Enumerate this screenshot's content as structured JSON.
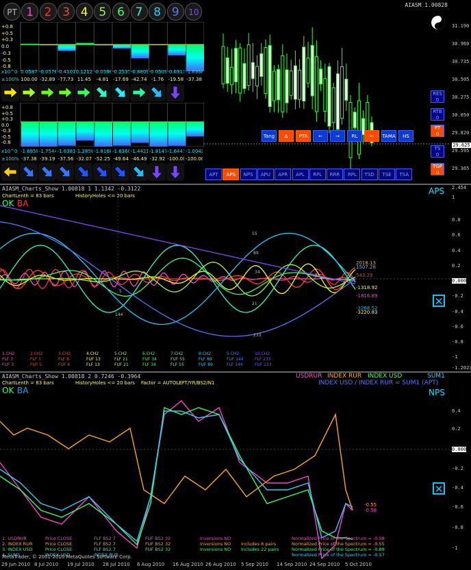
{
  "top": {
    "title": "AIASM 1.00828",
    "pt_label": "PT",
    "num_buttons": [
      {
        "label": "1",
        "color": "#ff44cc"
      },
      {
        "label": "2",
        "color": "#ff3333"
      },
      {
        "label": "3",
        "color": "#ff4422"
      },
      {
        "label": "4",
        "color": "#ffff00"
      },
      {
        "label": "5",
        "color": "#99ff33"
      },
      {
        "label": "6",
        "color": "#33ff66"
      },
      {
        "label": "7",
        "color": "#22ffcc"
      },
      {
        "label": "8",
        "color": "#22ccff"
      },
      {
        "label": "9",
        "color": "#5577ff"
      },
      {
        "label": "10",
        "color": "#8844ff"
      }
    ],
    "scale_a": [
      "+0.8",
      "+0.5",
      "+0.3",
      "0.0",
      "-0.3",
      "-0.5",
      "-0.8"
    ],
    "factor_label": "x10^0",
    "row_a_values": [
      "0.0587",
      "-0.0576",
      "-0.4101",
      "0.1212",
      "-0.0596",
      "-0.2535",
      "-0.8809",
      "-0.0509",
      "-0.6913",
      "-1.6958"
    ],
    "pct_label": "±100%",
    "row_a_pct": [
      "100.00",
      "-32.89",
      "-77.73",
      "11.45",
      "-4.81",
      "-17.69",
      "-42.74",
      "-1.76",
      "-19.58",
      "-37.38"
    ],
    "row_b_values": [
      "-1.6958",
      "-1.7544",
      "-1.6381",
      "-1.2856",
      "-1.8168",
      "-1.6360",
      "-1.4421",
      "-1.8147",
      "-1.6447",
      "-1.0043"
    ],
    "row_b_pct": [
      "-37.38",
      "-39.19",
      "-37.56",
      "-32.07",
      "-52.25",
      "-49.64",
      "-46.49",
      "-32.92",
      "-100.00",
      "-100.00"
    ],
    "price_ticks": [
      "31.190",
      "30.960",
      "30.735",
      "30.505",
      "30.275",
      "30.050",
      "29.820",
      "29.595",
      "29.365"
    ],
    "price_current": "29.625",
    "toolbar_row1": [
      "Tang",
      "Δ",
      "PTA",
      "←",
      "→",
      "RL",
      "←",
      "TAMA",
      "HS"
    ],
    "toolbar_row2": [
      "APT",
      "APS",
      "NPS",
      "APU",
      "APR",
      "APL",
      "RPL",
      "RRR",
      "RPL",
      "TSD",
      "TSE",
      "TSA"
    ],
    "side_buttons": [
      [
        "RES",
        "0"
      ],
      [
        "RTB",
        "0"
      ],
      [
        "PT",
        "0"
      ],
      [
        "TS",
        "0"
      ],
      [
        "TGP",
        "0"
      ]
    ]
  },
  "pane_aps": {
    "title": "AIASM_Charts_Show 1.00818 1 1.1342 -0.3122",
    "chartlength": "ChartLenth = 83 bars",
    "historyholes": "HistoryHoles <= 20 bars",
    "ok": "OK",
    "ba": "BA",
    "name": "APS",
    "y_ticks": [
      "2.454",
      "1",
      "0.8",
      "0.6",
      "0.4",
      "0.2",
      "0.000",
      "-0.2",
      "-0.4",
      "-0.6",
      "-0.8",
      "-1",
      "-1.2023"
    ],
    "right_labels": [
      {
        "text": "2018.13",
        "color": "#ffaa00"
      },
      {
        "text": "1507.28",
        "color": "#33ccff"
      },
      {
        "text": "543.29",
        "color": "#ff3333"
      },
      {
        "text": "-1318.92",
        "color": "#ffff00"
      },
      {
        "text": "-1816.89",
        "color": "#ff44cc"
      },
      {
        "text": "-3268.52",
        "color": "#00ccff"
      },
      {
        "text": "-3220.83",
        "color": "#ffff00"
      }
    ],
    "curve_labels": [
      "55",
      "89",
      "34",
      "8",
      "5",
      "21",
      "144",
      "233"
    ],
    "legend": [
      {
        "ch": "1.CH2",
        "fuf": "FLF  3",
        "color": "#ff44cc"
      },
      {
        "ch": "2.CH2",
        "fuf": "FLF  5",
        "color": "#ff3333"
      },
      {
        "ch": "3.CH2",
        "fuf": "FLF  8",
        "color": "#ff4422"
      },
      {
        "ch": "4.CH2",
        "fuf": "FUF 13",
        "color": "#ffff00"
      },
      {
        "ch": "5.CH2",
        "fuf": "FLF 21",
        "color": "#99ff33"
      },
      {
        "ch": "6.CH2",
        "fuf": "FUF 34",
        "color": "#33ff66"
      },
      {
        "ch": "7.CH2",
        "fuf": "FUF 55",
        "color": "#22ffcc"
      },
      {
        "ch": "8.CH2",
        "fuf": "FLF 89",
        "color": "#22ccff"
      },
      {
        "ch": "9.CH2",
        "fuf": "FUF 144",
        "color": "#5577ff"
      },
      {
        "ch": "10.CH2",
        "fuf": "FLF 233",
        "color": "#8844ff"
      }
    ],
    "legend_extra": [
      "FUF  3",
      "FUF  5",
      "FUF  8",
      "FLF 13",
      "FUF 21",
      "FLF 34",
      "FLF 55",
      "FUF 89",
      "FLF 144",
      "FUF 233"
    ]
  },
  "pane_nps": {
    "title": "AIASM_Charts_Show 1.00818 2 0.7246 -0.3964",
    "chartlength": "ChartLenth = 83 bars",
    "historyholes": "HistoryHoles <= 20 bars",
    "factor": "Factor = AUTOLEFT/YR/BS2/N1",
    "ok": "OK",
    "ba": "BA",
    "name": "NPS",
    "legend_top": [
      "USDRUR",
      "INDEX RUR",
      "INDEX USD",
      "SUM1"
    ],
    "legend_top2": "INDEX USD / INDEX RUR = SUM1 (APT)",
    "y_ticks": [
      "0.4",
      "0.2",
      "0.000",
      "-0.2",
      "-0.4",
      "-0.6",
      "-0.8",
      "-1"
    ],
    "right_labels": [
      {
        "text": "-0.55",
        "color": "#ffaa00"
      },
      {
        "text": "-0.58",
        "color": "#ff44cc"
      }
    ],
    "bottom_rows": [
      {
        "c1": "1. USDRUR",
        "c2": "Price CLOSE",
        "c3": "FLF BS2 7",
        "c4": "FUF BS2 32",
        "c5": "Inversions NO",
        "c6": "",
        "c7": "Normalized Price of the Spectrum = -0.58",
        "color": "#ff44cc"
      },
      {
        "c1": "2. INDEX RUR",
        "c2": "Price CLOSE",
        "c3": "FLF BS2 7",
        "c4": "FUF BS2 32",
        "c5": "Inversions NO",
        "c6": "Includes 8 pairs",
        "c7": "Normalized Price of the Spectrum = -0.55",
        "color": "#ffaa00"
      },
      {
        "c1": "3. INDEX USD",
        "c2": "Price CLOSE",
        "c3": "FLF BS2 7",
        "c4": "FUF BS2 32",
        "c5": "Inversions NO",
        "c6": "Includes 22 pairs",
        "c7": "Normalized Price of the Spectrum = -0.89",
        "color": "#33ff66"
      },
      {
        "c1": "4. SUM1",
        "c2": "INDEX USD",
        "c3": "INDEX RUR",
        "c4": "",
        "c5": "",
        "c6": "",
        "c7": "Normalized Price of the Spectrum = -0.57",
        "color": "#33ccff"
      }
    ],
    "copyright": "MetaTrader, © 2001-2010 MetaQuotes Software Corp."
  },
  "x_axis": [
    "29 Jun 2010",
    "8 Jul 2010",
    "19 Jul 2010",
    "28 Jul 2010",
    "6 Aug 2010",
    "16 Aug 2010",
    "26 Aug 2010",
    "5 Sep 2010",
    "14 Sep 2010",
    "24 Sep 2010",
    "5 Oct 2010"
  ]
}
